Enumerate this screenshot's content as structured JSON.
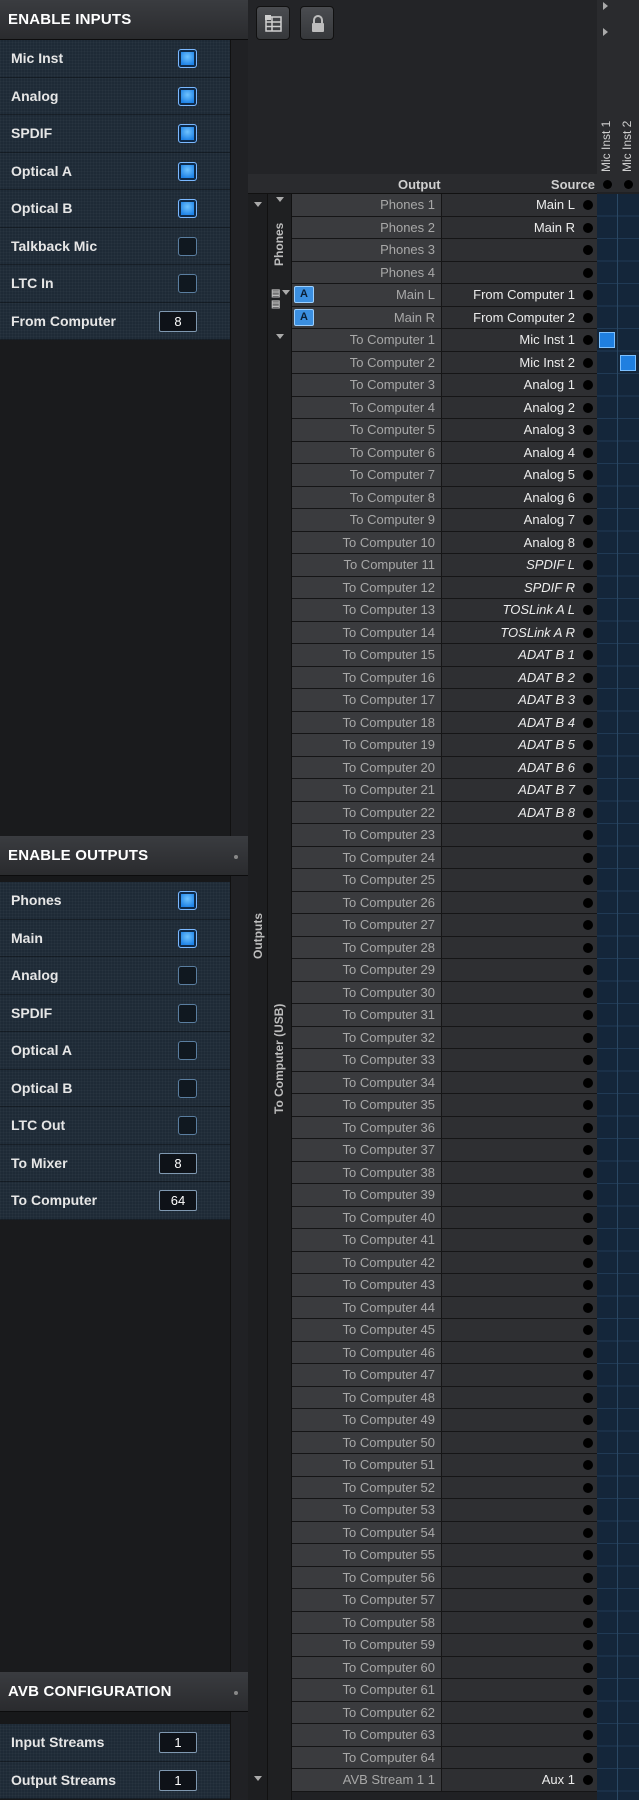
{
  "enable_inputs": {
    "title": "ENABLE INPUTS",
    "items": [
      {
        "label": "Mic Inst",
        "type": "checkbox",
        "checked": true
      },
      {
        "label": "Analog",
        "type": "checkbox",
        "checked": true
      },
      {
        "label": "SPDIF",
        "type": "checkbox",
        "checked": true
      },
      {
        "label": "Optical A",
        "type": "checkbox",
        "checked": true
      },
      {
        "label": "Optical B",
        "type": "checkbox",
        "checked": true
      },
      {
        "label": "Talkback Mic",
        "type": "checkbox",
        "checked": false
      },
      {
        "label": "LTC In",
        "type": "checkbox",
        "checked": false
      },
      {
        "label": "From Computer",
        "type": "number",
        "value": "8"
      }
    ]
  },
  "enable_outputs": {
    "title": "ENABLE OUTPUTS",
    "items": [
      {
        "label": "Phones",
        "type": "checkbox",
        "checked": true
      },
      {
        "label": "Main",
        "type": "checkbox",
        "checked": true
      },
      {
        "label": "Analog",
        "type": "checkbox",
        "checked": false
      },
      {
        "label": "SPDIF",
        "type": "checkbox",
        "checked": false
      },
      {
        "label": "Optical A",
        "type": "checkbox",
        "checked": false
      },
      {
        "label": "Optical B",
        "type": "checkbox",
        "checked": false
      },
      {
        "label": "LTC Out",
        "type": "checkbox",
        "checked": false
      },
      {
        "label": "To Mixer",
        "type": "number",
        "value": "8"
      },
      {
        "label": "To Computer",
        "type": "number",
        "value": "64"
      }
    ]
  },
  "avb": {
    "title": "AVB CONFIGURATION",
    "items": [
      {
        "label": "Input Streams",
        "type": "number",
        "value": "1"
      },
      {
        "label": "Output Streams",
        "type": "number",
        "value": "1"
      }
    ]
  },
  "table": {
    "output_header": "Output",
    "source_header": "Source",
    "group_outputs": "Outputs",
    "group_phones": "Phones",
    "group_to_computer": "To Computer (USB)",
    "columns": [
      "Mic Inst 1",
      "Mic Inst 2"
    ],
    "rows": [
      {
        "output": "Phones 1",
        "source": "Main L"
      },
      {
        "output": "Phones 2",
        "source": "Main R"
      },
      {
        "output": "Phones 3",
        "source": ""
      },
      {
        "output": "Phones 4",
        "source": ""
      },
      {
        "output": "Main L",
        "source": "From Computer 1",
        "badge": "A"
      },
      {
        "output": "Main R",
        "source": "From Computer 2",
        "badge": "A"
      },
      {
        "output": "To Computer 1",
        "source": "Mic Inst 1",
        "cell": 0
      },
      {
        "output": "To Computer 2",
        "source": "Mic Inst 2",
        "cell": 1
      },
      {
        "output": "To Computer 3",
        "source": "Analog 1"
      },
      {
        "output": "To Computer 4",
        "source": "Analog 2"
      },
      {
        "output": "To Computer 5",
        "source": "Analog 3"
      },
      {
        "output": "To Computer 6",
        "source": "Analog 4"
      },
      {
        "output": "To Computer 7",
        "source": "Analog 5"
      },
      {
        "output": "To Computer 8",
        "source": "Analog 6"
      },
      {
        "output": "To Computer 9",
        "source": "Analog 7"
      },
      {
        "output": "To Computer 10",
        "source": "Analog 8"
      },
      {
        "output": "To Computer 11",
        "source": "SPDIF L",
        "italic": true
      },
      {
        "output": "To Computer 12",
        "source": "SPDIF R",
        "italic": true
      },
      {
        "output": "To Computer 13",
        "source": "TOSLink A L",
        "italic": true
      },
      {
        "output": "To Computer 14",
        "source": "TOSLink A R",
        "italic": true
      },
      {
        "output": "To Computer 15",
        "source": "ADAT B 1",
        "italic": true
      },
      {
        "output": "To Computer 16",
        "source": "ADAT B 2",
        "italic": true
      },
      {
        "output": "To Computer 17",
        "source": "ADAT B 3",
        "italic": true
      },
      {
        "output": "To Computer 18",
        "source": "ADAT B 4",
        "italic": true
      },
      {
        "output": "To Computer 19",
        "source": "ADAT B 5",
        "italic": true
      },
      {
        "output": "To Computer 20",
        "source": "ADAT B 6",
        "italic": true
      },
      {
        "output": "To Computer 21",
        "source": "ADAT B 7",
        "italic": true
      },
      {
        "output": "To Computer 22",
        "source": "ADAT B 8",
        "italic": true
      },
      {
        "output": "To Computer 23",
        "source": ""
      },
      {
        "output": "To Computer 24",
        "source": ""
      },
      {
        "output": "To Computer 25",
        "source": ""
      },
      {
        "output": "To Computer 26",
        "source": ""
      },
      {
        "output": "To Computer 27",
        "source": ""
      },
      {
        "output": "To Computer 28",
        "source": ""
      },
      {
        "output": "To Computer 29",
        "source": ""
      },
      {
        "output": "To Computer 30",
        "source": ""
      },
      {
        "output": "To Computer 31",
        "source": ""
      },
      {
        "output": "To Computer 32",
        "source": ""
      },
      {
        "output": "To Computer 33",
        "source": ""
      },
      {
        "output": "To Computer 34",
        "source": ""
      },
      {
        "output": "To Computer 35",
        "source": ""
      },
      {
        "output": "To Computer 36",
        "source": ""
      },
      {
        "output": "To Computer 37",
        "source": ""
      },
      {
        "output": "To Computer 38",
        "source": ""
      },
      {
        "output": "To Computer 39",
        "source": ""
      },
      {
        "output": "To Computer 40",
        "source": ""
      },
      {
        "output": "To Computer 41",
        "source": ""
      },
      {
        "output": "To Computer 42",
        "source": ""
      },
      {
        "output": "To Computer 43",
        "source": ""
      },
      {
        "output": "To Computer 44",
        "source": ""
      },
      {
        "output": "To Computer 45",
        "source": ""
      },
      {
        "output": "To Computer 46",
        "source": ""
      },
      {
        "output": "To Computer 47",
        "source": ""
      },
      {
        "output": "To Computer 48",
        "source": ""
      },
      {
        "output": "To Computer 49",
        "source": ""
      },
      {
        "output": "To Computer 50",
        "source": ""
      },
      {
        "output": "To Computer 51",
        "source": ""
      },
      {
        "output": "To Computer 52",
        "source": ""
      },
      {
        "output": "To Computer 53",
        "source": ""
      },
      {
        "output": "To Computer 54",
        "source": ""
      },
      {
        "output": "To Computer 55",
        "source": ""
      },
      {
        "output": "To Computer 56",
        "source": ""
      },
      {
        "output": "To Computer 57",
        "source": ""
      },
      {
        "output": "To Computer 58",
        "source": ""
      },
      {
        "output": "To Computer 59",
        "source": ""
      },
      {
        "output": "To Computer 60",
        "source": ""
      },
      {
        "output": "To Computer 61",
        "source": ""
      },
      {
        "output": "To Computer 62",
        "source": ""
      },
      {
        "output": "To Computer 63",
        "source": ""
      },
      {
        "output": "To Computer 64",
        "source": ""
      },
      {
        "output": "AVB Stream 1 1",
        "source": "Aux 1"
      }
    ]
  },
  "icons": {
    "toolbar_1": "routing-grid-icon",
    "toolbar_2": "lock-icon"
  },
  "colors": {
    "accent": "#1f7fe0",
    "panel_bg": "#1e2a36",
    "row_bg": "#3a3b3e"
  }
}
